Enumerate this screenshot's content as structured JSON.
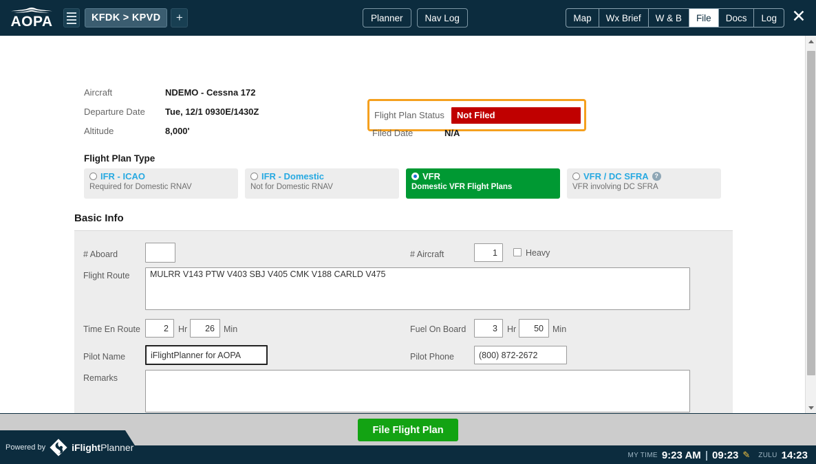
{
  "topbar": {
    "brand": "AOPA",
    "hamburger_icon": "hamburger-menu-icon",
    "route_chip": "KFDK > KPVD",
    "add_tab": "+",
    "center_buttons": [
      {
        "label": "Planner"
      },
      {
        "label": "Nav Log"
      }
    ],
    "segments": [
      {
        "label": "Map",
        "active": false
      },
      {
        "label": "Wx Brief",
        "active": false
      },
      {
        "label": "W & B",
        "active": false
      },
      {
        "label": "File",
        "active": true
      },
      {
        "label": "Docs",
        "active": false
      },
      {
        "label": "Log",
        "active": false
      }
    ],
    "close_icon": "✕"
  },
  "summary": {
    "aircraft_label": "Aircraft",
    "aircraft_value": "NDEMO - Cessna 172",
    "departure_label": "Departure Date",
    "departure_value": "Tue, 12/1 0930E/1430Z",
    "altitude_label": "Altitude",
    "altitude_value": "8,000'"
  },
  "status": {
    "label": "Flight Plan Status",
    "value": "Not Filed",
    "filed_date_label": "Filed Date",
    "filed_date_value": "N/A",
    "highlight_color": "#f5a01e",
    "pill_color": "#c00000"
  },
  "flight_plan_type": {
    "title": "Flight Plan Type",
    "options": [
      {
        "label": "IFR - ICAO",
        "sub": "Required for Domestic RNAV",
        "selected": false,
        "help": false
      },
      {
        "label": "IFR - Domestic",
        "sub": "Not for Domestic RNAV",
        "selected": false,
        "help": false
      },
      {
        "label": "VFR",
        "sub": "Domestic VFR Flight Plans",
        "selected": true,
        "help": false
      },
      {
        "label": "VFR / DC SFRA",
        "sub": "VFR involving DC SFRA",
        "selected": false,
        "help": true
      }
    ],
    "selected_color": "#009933",
    "link_color": "#27a9e1"
  },
  "basic_info": {
    "title": "Basic Info",
    "aboard_label": "# Aboard",
    "aboard_value": "",
    "aircraft_count_label": "# Aircraft",
    "aircraft_count_value": "1",
    "heavy_label": "Heavy",
    "heavy_checked": false,
    "route_label": "Flight Route",
    "route_value": "MULRR V143 PTW V403 SBJ V405 CMK V188 CARLD V475",
    "time_enroute_label": "Time En Route",
    "time_enroute_hr": "2",
    "time_enroute_min": "26",
    "hr_unit": "Hr",
    "min_unit": "Min",
    "fuel_label": "Fuel On Board",
    "fuel_hr": "3",
    "fuel_min": "50",
    "pilot_name_label": "Pilot Name",
    "pilot_name_value": "iFlightPlanner for AOPA",
    "pilot_phone_label": "Pilot Phone",
    "pilot_phone_value": "(800) 872-2672",
    "remarks_label": "Remarks",
    "remarks_value": ""
  },
  "actions": {
    "file_button": "File Flight Plan",
    "file_button_color": "#13a313"
  },
  "footer": {
    "powered_by": "Powered by",
    "brand_bold": "iFlight",
    "brand_light": "Planner",
    "my_time_caption": "MY TIME",
    "my_time_value": "9:23 AM",
    "separator": "|",
    "alt_time_value": "09:23",
    "edit_icon": "✎",
    "zulu_caption": "ZULU",
    "zulu_value": "14:23"
  },
  "scrollbar": {
    "up_icon": "scroll-up-arrow",
    "down_icon": "scroll-down-arrow"
  }
}
